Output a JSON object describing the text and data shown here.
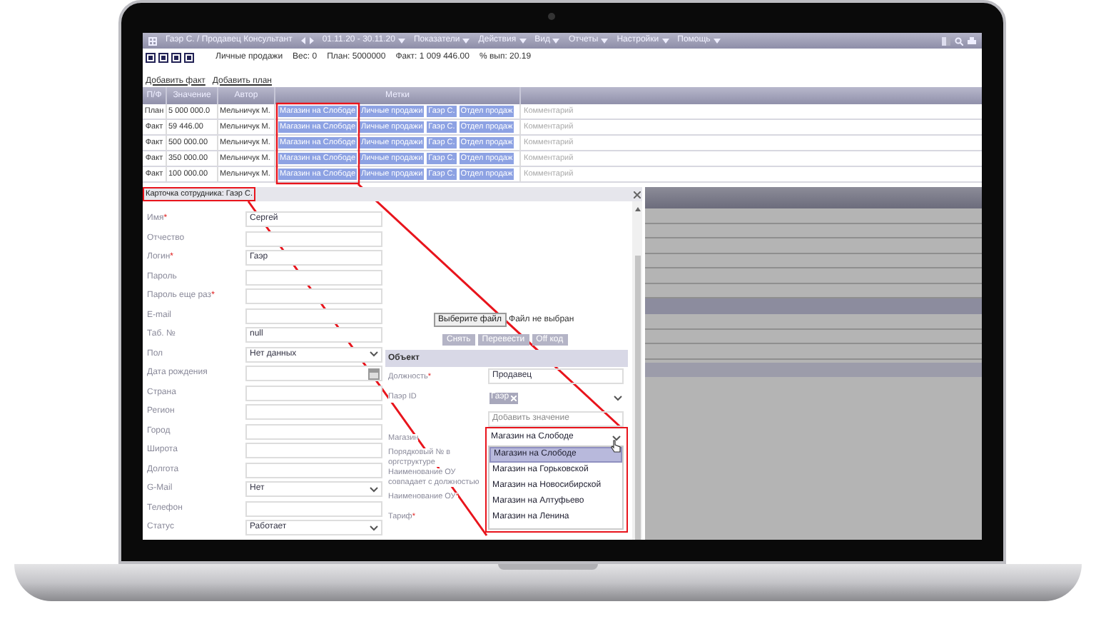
{
  "menu_bar": {
    "title": "Гаэр С. / Продавец Консультант",
    "period": "01.11.20 - 30.11.20",
    "menus": [
      "Показатели",
      "Действия",
      "Вид",
      "Отчеты",
      "Настройки",
      "Помощь"
    ]
  },
  "summary": {
    "name": "Личные продажи",
    "weight": "Вес: 0",
    "plan": "План: 5000000",
    "fact": "Факт: 1 009 446.00",
    "percent": "% вып: 20.19"
  },
  "links": [
    "Добавить факт",
    "Добавить план"
  ],
  "table": {
    "columns": [
      "П/Ф",
      "Значение",
      "Автор",
      "Метки"
    ],
    "rows": [
      {
        "type": "План",
        "value": "5 000 000.0",
        "author": "Мельничук М.",
        "tags": [
          "Магазин на Слободе",
          "Личные продажи",
          "Гаэр С.",
          "Отдел продаж"
        ],
        "comment": "Комментарий"
      },
      {
        "type": "Факт",
        "value": "59 446.00",
        "author": "Мельничук М.",
        "tags": [
          "Магазин на Слободе",
          "Личные продажи",
          "Гаэр С.",
          "Отдел продаж"
        ],
        "comment": "Комментарий"
      },
      {
        "type": "Факт",
        "value": "500 000.00",
        "author": "Мельничук М.",
        "tags": [
          "Магазин на Слободе",
          "Личные продажи",
          "Гаэр С.",
          "Отдел продаж"
        ],
        "comment": "Комментарий"
      },
      {
        "type": "Факт",
        "value": "350 000.00",
        "author": "Мельничук М.",
        "tags": [
          "Магазин на Слободе",
          "Личные продажи",
          "Гаэр С.",
          "Отдел продаж"
        ],
        "comment": "Комментарий"
      },
      {
        "type": "Факт",
        "value": "100 000.00",
        "author": "Мельничук М.",
        "tags": [
          "Магазин на Слободе",
          "Личные продажи",
          "Гаэр С.",
          "Отдел продаж"
        ],
        "comment": "Комментарий"
      }
    ]
  },
  "dialog": {
    "title": "Карточка сотрудника: Гаэр С.",
    "fields": [
      {
        "label": "Имя",
        "required_mark": "*",
        "kind": "text",
        "value": "Сергей"
      },
      {
        "label": "Отчество",
        "kind": "text"
      },
      {
        "label": "Логин",
        "required_mark": "*",
        "kind": "text",
        "value": "Гаэр"
      },
      {
        "label": "Пароль",
        "kind": "text"
      },
      {
        "label": "Пароль еще раз",
        "required_mark": "*",
        "kind": "text"
      },
      {
        "label": "E-mail",
        "kind": "text"
      },
      {
        "label": "Таб. №",
        "kind": "text",
        "value": "null"
      },
      {
        "label": "Пол",
        "kind": "select",
        "value": "Нет данных"
      },
      {
        "label": "Дата рождения",
        "kind": "date"
      },
      {
        "label": "Страна",
        "kind": "text"
      },
      {
        "label": "Регион",
        "kind": "text"
      },
      {
        "label": "Город",
        "kind": "text"
      },
      {
        "label": "Широта",
        "kind": "text"
      },
      {
        "label": "Долгота",
        "kind": "text"
      },
      {
        "label": "G-Mail",
        "kind": "select",
        "value": "Нет"
      },
      {
        "label": "Телефон",
        "kind": "text"
      },
      {
        "label": "Статус",
        "kind": "select",
        "value": "Работает"
      }
    ],
    "file_button": "Выберите файл",
    "file_status": "Файл не выбран",
    "actions": [
      "Снять",
      "Перевести",
      "Off код"
    ],
    "section": "Объект",
    "object_fields": [
      {
        "label": "Должность",
        "required_mark": "*",
        "kind": "text",
        "value": "Продавец"
      },
      {
        "label": "Паэр ID",
        "kind": "chips",
        "chips": [
          "Гаэр"
        ]
      },
      {
        "kind": "add",
        "placeholder": "Добавить значение"
      },
      {
        "label": "Магазин",
        "kind": "dropdown",
        "value": "Магазин на Слободе",
        "options": [
          {
            "label": "Магазин на Слободе",
            "selected": true
          },
          {
            "label": "Магазин на Горьковской",
            "selected": false
          },
          {
            "label": "Магазин на Новосибирской",
            "selected": false
          },
          {
            "label": "Магазин на Алтуфьево",
            "selected": false
          },
          {
            "label": "Магазин на Ленина",
            "selected": false
          }
        ]
      },
      {
        "label": "Порядковый № в оргструктуре",
        "kind": "label"
      },
      {
        "label": "Наименование ОУ совпадает с должностью",
        "kind": "label"
      },
      {
        "label": "Наименование ОУ",
        "required_mark": "*",
        "kind": "label"
      },
      {
        "label": "Тариф",
        "required_mark": "*",
        "kind": "label"
      }
    ]
  }
}
